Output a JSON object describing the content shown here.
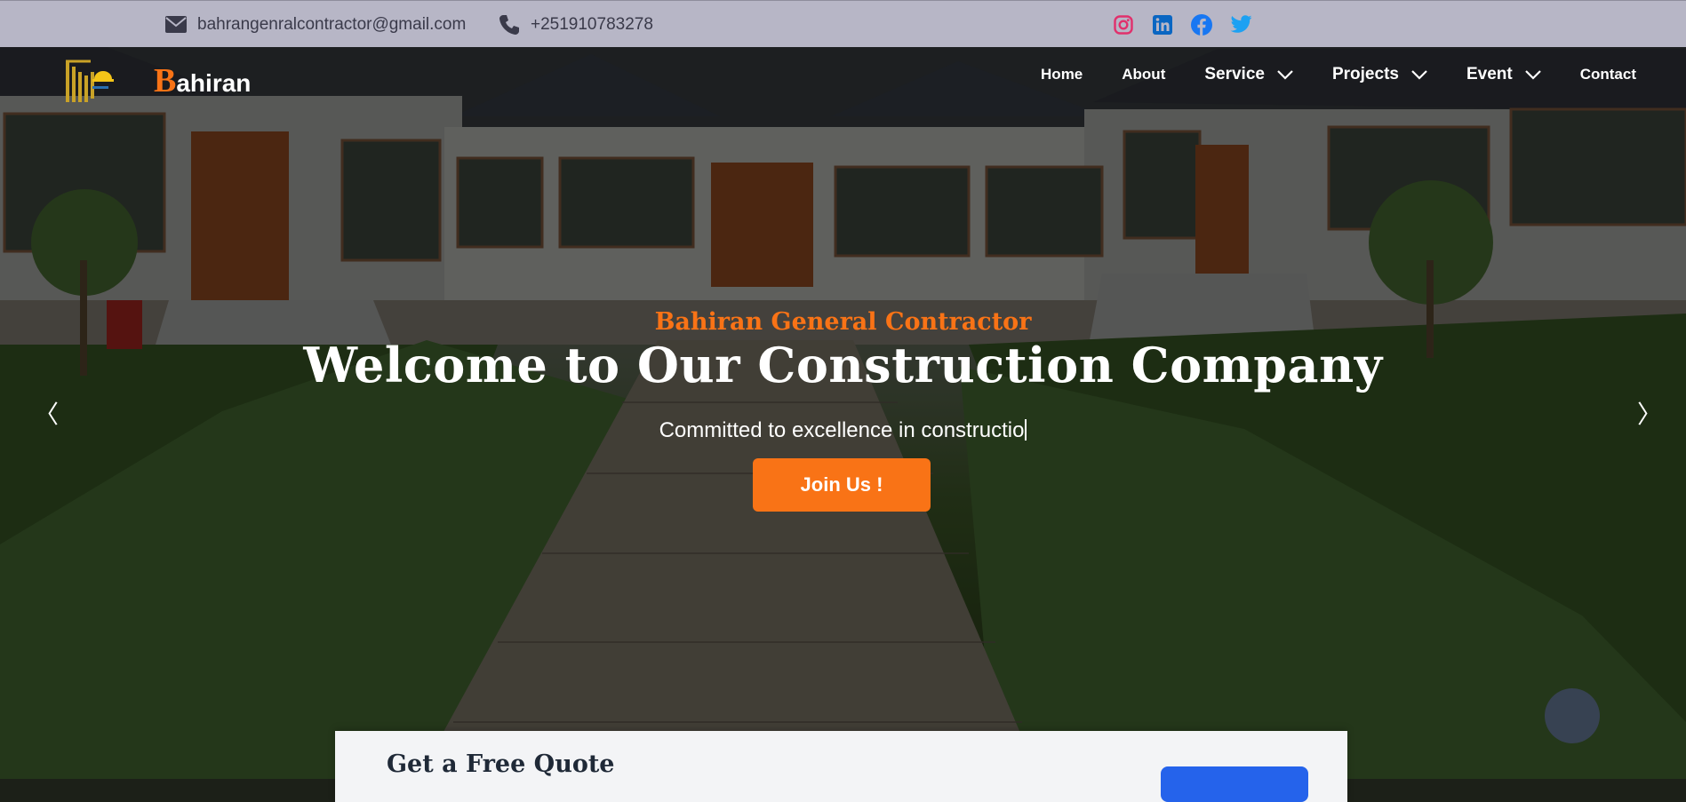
{
  "topbar": {
    "email": "bahrangenralcontractor@gmail.com",
    "phone": "+251910783278",
    "email_icon": "envelope-icon",
    "phone_icon": "phone-icon",
    "socials": [
      {
        "name": "instagram-icon",
        "color": "#e1306c"
      },
      {
        "name": "linkedin-icon",
        "color": "#0a66c2"
      },
      {
        "name": "facebook-icon",
        "color": "#1877f2"
      },
      {
        "name": "twitter-icon",
        "color": "#1da1f2"
      }
    ]
  },
  "brand": {
    "initial": "B",
    "rest": "ahiran",
    "accent_color": "#f97316"
  },
  "nav": {
    "home": "Home",
    "about": "About",
    "service": "Service",
    "projects": "Projects",
    "event": "Event",
    "contact": "Contact"
  },
  "hero": {
    "subtitle": "Bahiran General Contractor",
    "headline": "Welcome to Our Construction Company",
    "tagline": "Committed to excellence in constructio",
    "cta": "Join Us !",
    "prev": "〈",
    "next": "〉"
  },
  "quote": {
    "title": "Get a Free Quote"
  }
}
